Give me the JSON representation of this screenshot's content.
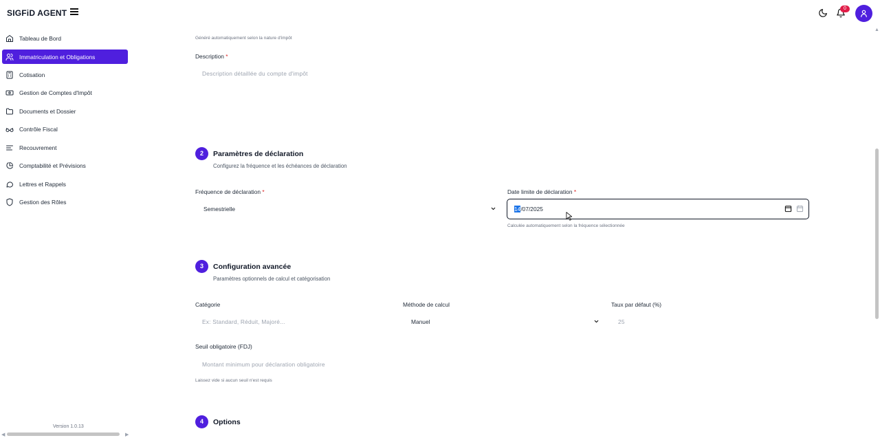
{
  "app": {
    "title": "SIGFiD AGENT",
    "version": "Version 1.0.13",
    "notification_count": "0"
  },
  "sidebar": {
    "items": [
      {
        "label": "Tableau de Bord",
        "icon": "home-icon"
      },
      {
        "label": "Immatriculation et Obligations",
        "icon": "users-icon"
      },
      {
        "label": "Cotisation",
        "icon": "calculator-icon"
      },
      {
        "label": "Gestion de Comptes d'Impôt",
        "icon": "banknote-icon"
      },
      {
        "label": "Documents et Dossier",
        "icon": "folder-icon"
      },
      {
        "label": "Contrôle Fiscal",
        "icon": "glasses-icon"
      },
      {
        "label": "Recouvrement",
        "icon": "list-icon"
      },
      {
        "label": "Comptabilité et Prévisions",
        "icon": "pie-chart-icon"
      },
      {
        "label": "Lettres et Rappels",
        "icon": "message-icon"
      },
      {
        "label": "Gestion des Rôles",
        "icon": "shield-icon"
      }
    ]
  },
  "form": {
    "auto_hint": "Généré automatiquement selon la nature d'impôt",
    "description": {
      "label": "Description",
      "required": "*",
      "placeholder": "Description détaillée du compte d'impôt"
    },
    "section2": {
      "number": "2",
      "title": "Paramètres de déclaration",
      "subtitle": "Configurez la fréquence et les échéances de déclaration",
      "frequency": {
        "label": "Fréquence de déclaration",
        "required": "*",
        "value": "Semestrielle"
      },
      "deadline": {
        "label": "Date limite de déclaration",
        "required": "*",
        "day": "14",
        "rest": "/07/2025",
        "hint": "Calculée automatiquement selon la fréquence sélectionnée"
      }
    },
    "section3": {
      "number": "3",
      "title": "Configuration avancée",
      "subtitle": "Paramètres optionnels de calcul et catégorisation",
      "category": {
        "label": "Catégorie",
        "placeholder": "Ex: Standard, Réduit, Majoré..."
      },
      "method": {
        "label": "Méthode de calcul",
        "value": "Manuel"
      },
      "rate": {
        "label": "Taux par défaut (%)",
        "placeholder": "25"
      },
      "threshold": {
        "label": "Seuil obligatoire (FDJ)",
        "placeholder": "Montant minimum pour déclaration obligatoire",
        "hint": "Laissez vide si aucun seuil n'est requis"
      }
    },
    "section4": {
      "number": "4",
      "title": "Options"
    }
  },
  "colors": {
    "accent": "#4f1fde",
    "badge": "#e11d48",
    "required": "#dc2626"
  }
}
